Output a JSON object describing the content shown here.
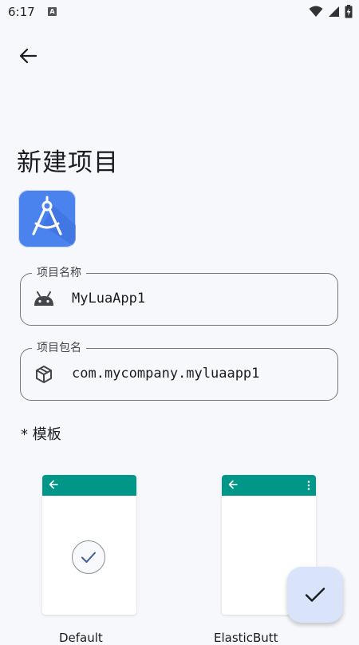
{
  "status_bar": {
    "time": "6:17",
    "notification_letter": "A",
    "icons": [
      "wifi-icon",
      "signal-icon",
      "battery-charging-icon"
    ]
  },
  "toolbar": {
    "back_icon": "arrow-back-icon"
  },
  "page": {
    "title": "新建项目"
  },
  "app_icon": {
    "icon": "compass-drafting-icon",
    "color": "#4a82ee"
  },
  "form": {
    "project_name": {
      "label": "项目名称",
      "value": "MyLuaApp1",
      "icon": "android-icon"
    },
    "package_name": {
      "label": "项目包名",
      "value": "com.mycompany.myluaapp1",
      "icon": "package-icon"
    }
  },
  "templates": {
    "label": "* 模板",
    "toolbar_color": "#009688",
    "items": [
      {
        "name": "Default",
        "selected": true
      },
      {
        "name": "ElasticButt",
        "selected": false
      }
    ]
  },
  "fab": {
    "icon": "check-icon",
    "color": "#d9e4fb"
  }
}
